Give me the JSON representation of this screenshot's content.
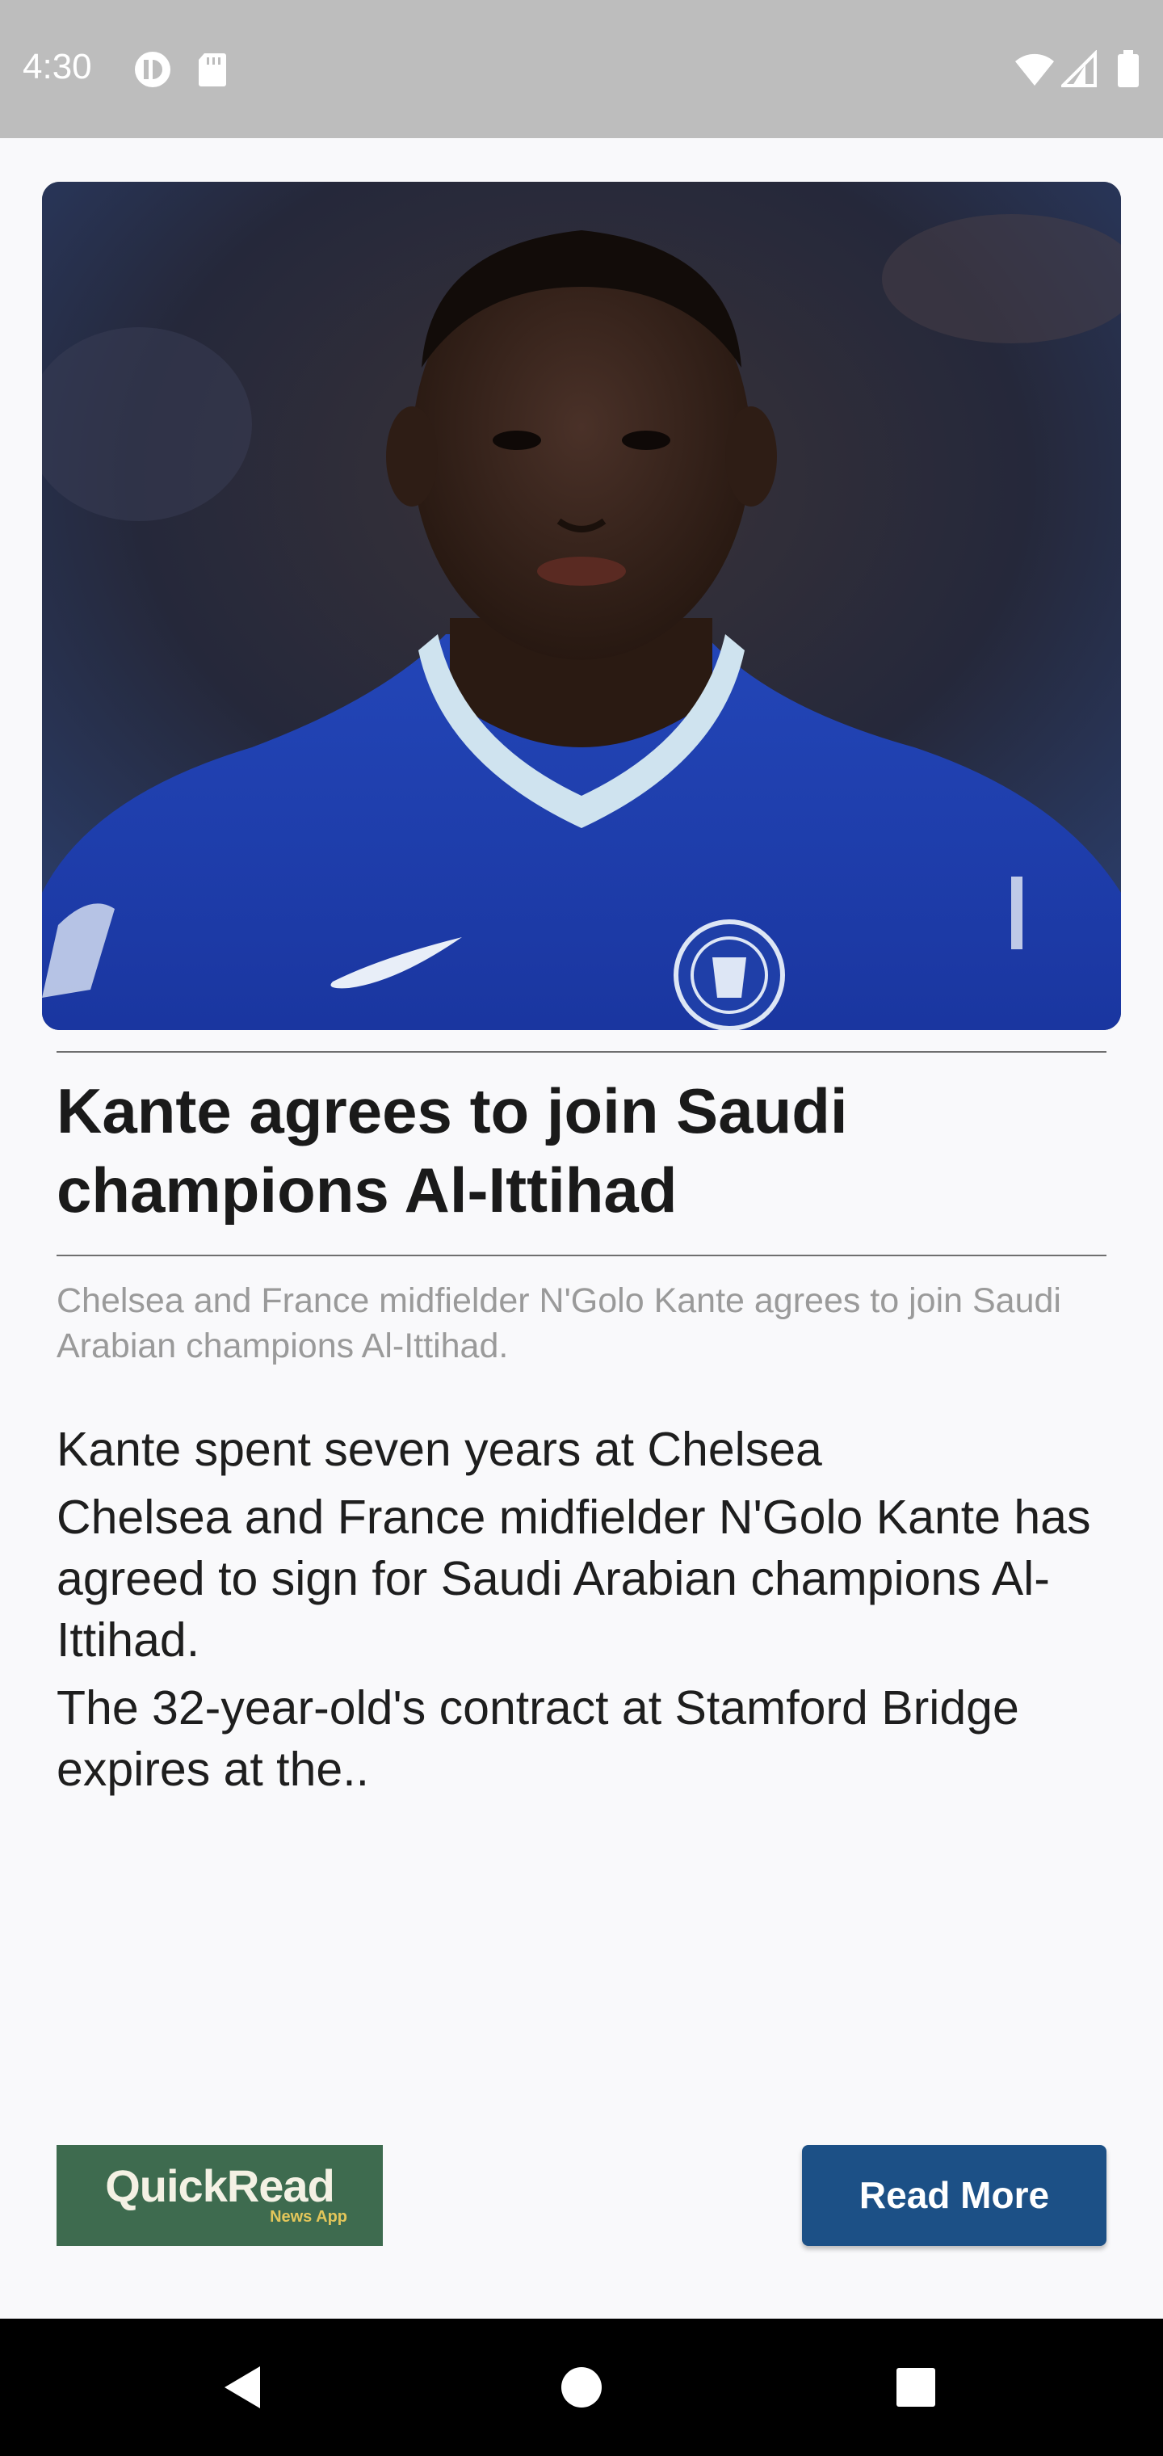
{
  "status_bar": {
    "time": "4:30",
    "left_icons": [
      "sync-icon",
      "sd-card-icon"
    ],
    "right_icons": [
      "wifi-icon",
      "cellular-signal-icon",
      "battery-icon"
    ]
  },
  "article": {
    "image_alt": "",
    "headline": "Kante agrees to join Saudi champions Al-Ittihad",
    "summary": "Chelsea and France midfielder N'Golo Kante agrees to join Saudi Arabian champions Al-Ittihad.",
    "body_paragraphs": [
      "Kante spent seven years at Chelsea",
      "Chelsea and France midfielder N'Golo Kante has agreed to sign for Saudi Arabian champions Al-Ittihad.",
      "The 32-year-old's contract at Stamford Bridge expires at the.."
    ]
  },
  "footer": {
    "logo_text": "QuickRead",
    "logo_subtext": "News App",
    "read_more_label": "Read More"
  },
  "nav_bar": {
    "icons": [
      "back-icon",
      "home-icon",
      "recents-icon"
    ]
  },
  "colors": {
    "status_bar": "#bdbdbd",
    "page_background": "#f9f9fb",
    "logo_background": "#3e6b4f",
    "button": "#1c5086",
    "nav_bar": "#000000"
  }
}
